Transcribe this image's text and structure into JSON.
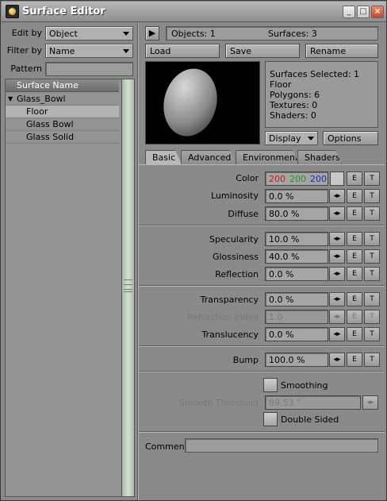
{
  "window": {
    "title": "Surface Editor",
    "btn_min": "_",
    "btn_max": "□",
    "btn_close": "×"
  },
  "left": {
    "edit_by_label": "Edit by",
    "edit_by_value": "Object",
    "filter_by_label": "Filter by",
    "filter_by_value": "Name",
    "pattern_label": "Pattern",
    "pattern_value": "",
    "list_header": "Surface Name",
    "tree_toggle": "▼",
    "items": [
      {
        "label": "Glass_Bowl"
      },
      {
        "label": "Floor"
      },
      {
        "label": "Glass Bowl"
      },
      {
        "label": "Glass Solid"
      }
    ]
  },
  "top": {
    "play_glyph": "▶",
    "objects_text": "Objects: 1",
    "surfaces_text": "Surfaces: 3",
    "load_label": "Load",
    "save_label": "Save",
    "rename_label": "Rename"
  },
  "info": {
    "lines": [
      "Surfaces Selected: 1",
      "Floor",
      "Polygons: 6",
      "Textures: 0",
      "Shaders: 0"
    ],
    "display_label": "Display",
    "options_label": "Options"
  },
  "tabs": [
    "Basic",
    "Advanced",
    "Environment",
    "Shaders"
  ],
  "color": {
    "label": "Color",
    "r": "200",
    "g": "200",
    "b": "200",
    "r_color": "#d01818",
    "g_color": "#1c9a1c",
    "b_color": "#1a2ad0",
    "swatch": "#c8c8c8"
  },
  "params": {
    "luminosity": {
      "label": "Luminosity",
      "value": "0.0 %"
    },
    "diffuse": {
      "label": "Diffuse",
      "value": "80.0 %"
    },
    "specularity": {
      "label": "Specularity",
      "value": "10.0 %"
    },
    "glossiness": {
      "label": "Glossiness",
      "value": "40.0 %"
    },
    "reflection": {
      "label": "Reflection",
      "value": "0.0 %"
    },
    "transparency": {
      "label": "Transparency",
      "value": "0.0 %"
    },
    "refraction": {
      "label": "Refraction Index",
      "value": "1.0"
    },
    "translucency": {
      "label": "Translucency",
      "value": "0.0 %"
    },
    "bump": {
      "label": "Bump",
      "value": "100.0 %"
    }
  },
  "env_glyph": "◂▸",
  "e_label": "E",
  "t_label": "T",
  "smoothing_label": "Smoothing",
  "smooth_threshold": {
    "label": "Smooth Threshold",
    "value": "89.53 °"
  },
  "double_sided_label": "Double Sided",
  "comment": {
    "label": "Comment",
    "value": ""
  }
}
